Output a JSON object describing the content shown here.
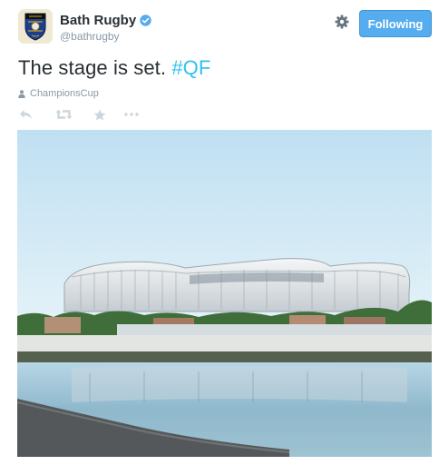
{
  "user": {
    "display_name": "Bath Rugby",
    "handle": "@bathrugby"
  },
  "follow_button": {
    "label": "Following"
  },
  "tweet": {
    "text": "The stage is set. ",
    "hashtag": "#QF"
  },
  "place": {
    "label": "ChampionsCup"
  },
  "actions": [
    "reply-icon",
    "retweet-icon",
    "favorite-icon",
    "more-icon"
  ],
  "colors": {
    "follow_button_bg": "#55acee",
    "hashtag": "#2fc2ef",
    "text": "#292f33",
    "meta": "#8899a6",
    "verified": "#55acee"
  }
}
